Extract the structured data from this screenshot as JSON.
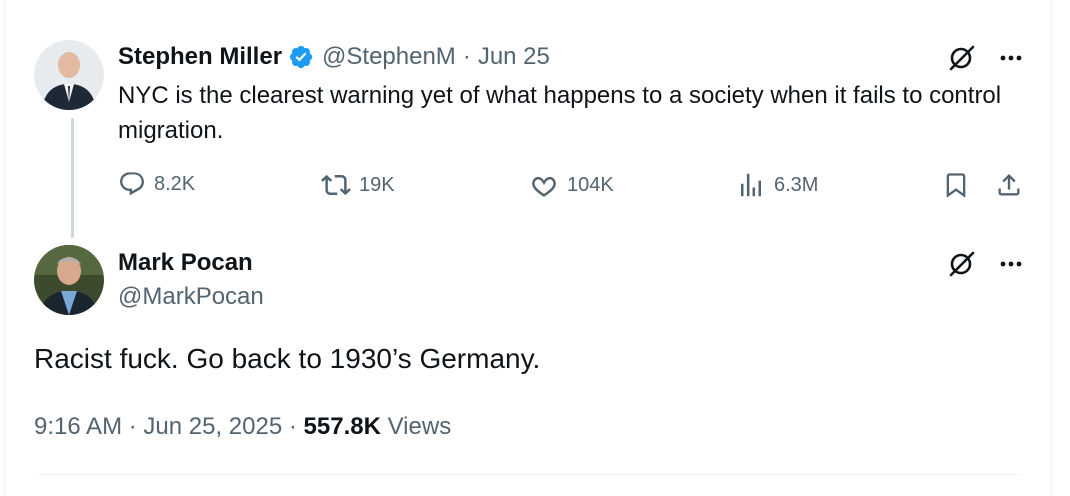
{
  "parent_tweet": {
    "author_name": "Stephen Miller",
    "handle": "@StephenM",
    "separator": "·",
    "date": "Jun 25",
    "text": "NYC is the clearest warning yet of what happens to a society when it fails to control migration.",
    "stats": {
      "replies": "8.2K",
      "retweets": "19K",
      "likes": "104K",
      "views": "6.3M"
    },
    "verified": true
  },
  "reply_tweet": {
    "author_name": "Mark Pocan",
    "handle": "@MarkPocan",
    "text": "Racist fuck. Go back to 1930’s Germany.",
    "time": "9:16 AM",
    "separator": "·",
    "date": "Jun 25, 2025",
    "views_count": "557.8K",
    "views_label": "Views"
  },
  "colors": {
    "verified_badge": "#1d9bf0",
    "text_primary": "#0f1419",
    "text_secondary": "#536471"
  },
  "icons": [
    "grok-icon",
    "more-icon",
    "reply-icon",
    "retweet-icon",
    "like-icon",
    "views-icon",
    "bookmark-icon",
    "share-icon",
    "verified-badge-icon"
  ]
}
